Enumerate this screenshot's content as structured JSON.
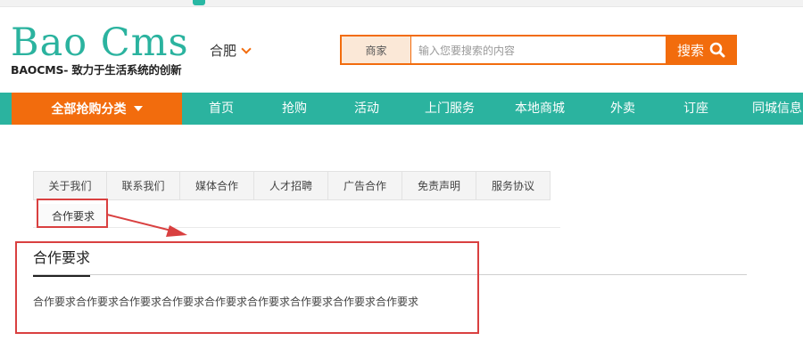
{
  "brand": {
    "logo_text": "Bao Cms",
    "tagline": "BAOCMS- 致力于生活系统的创新"
  },
  "location": {
    "city": "合肥"
  },
  "search": {
    "type_label": "商家",
    "placeholder": "输入您要搜索的内容",
    "button_label": "搜索"
  },
  "nav": {
    "category_label": "全部抢购分类",
    "items": [
      {
        "label": "首页"
      },
      {
        "label": "抢购"
      },
      {
        "label": "活动"
      },
      {
        "label": "上门服务"
      },
      {
        "label": "本地商城"
      },
      {
        "label": "外卖"
      },
      {
        "label": "订座"
      },
      {
        "label": "同城信息"
      }
    ]
  },
  "tabs": {
    "items": [
      {
        "label": "关于我们"
      },
      {
        "label": "联系我们"
      },
      {
        "label": "媒体合作"
      },
      {
        "label": "人才招聘"
      },
      {
        "label": "广告合作"
      },
      {
        "label": "免责声明"
      },
      {
        "label": "服务协议"
      }
    ],
    "active_label": "合作要求"
  },
  "content": {
    "title": "合作要求",
    "body": "合作要求合作要求合作要求合作要求合作要求合作要求合作要求合作要求合作要求"
  },
  "colors": {
    "brand_green": "#2bb39f",
    "accent_orange": "#f26c0d",
    "annotation_red": "#d94040"
  }
}
